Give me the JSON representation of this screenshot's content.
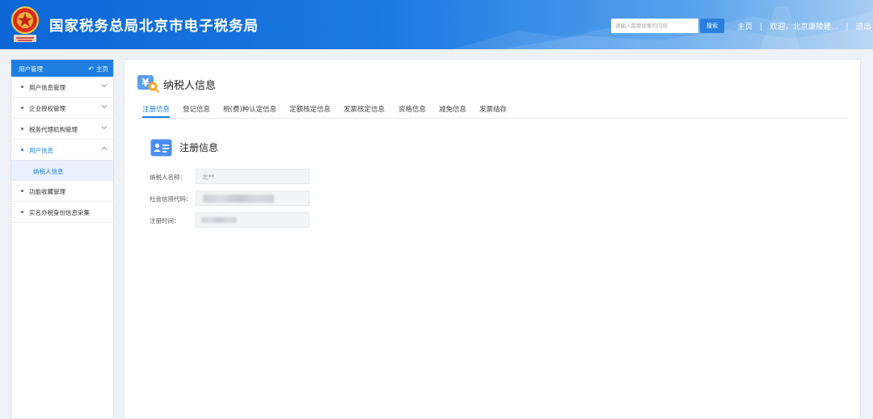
{
  "header": {
    "site_title": "国家税务总局北京市电子税务局",
    "search_placeholder": "请输入需要搜索的内容",
    "search_button": "搜索",
    "nav_home": "主页",
    "separator": "|",
    "welcome": "欢迎，北京康陵建...",
    "logout": "退出",
    "emblem_icon": "tax-emblem-icon"
  },
  "sidebar": {
    "header_title": "用户管理",
    "home_label": "主页",
    "items": [
      {
        "label": "用户信息管理",
        "expandable": true,
        "expanded": false
      },
      {
        "label": "企业授权管理",
        "expandable": true,
        "expanded": false
      },
      {
        "label": "税务代理机构管理",
        "expandable": true,
        "expanded": false
      },
      {
        "label": "用户信息",
        "expandable": true,
        "expanded": true,
        "active": true
      },
      {
        "label": "纳税人信息",
        "sub": true
      },
      {
        "label": "功能收藏管理",
        "expandable": false
      },
      {
        "label": "实名办税身份信息采集",
        "expandable": false
      }
    ]
  },
  "main": {
    "page_title": "纳税人信息",
    "tabs": [
      "注册信息",
      "登记信息",
      "税(费)种认定信息",
      "定额核定信息",
      "发票核定信息",
      "资格信息",
      "减免信息",
      "发票结存"
    ],
    "active_tab": 0,
    "section_title": "注册信息",
    "fields": [
      {
        "label": "纳税人名称：",
        "value": "北**"
      },
      {
        "label": "社会信用代码：",
        "value": ""
      },
      {
        "label": "注册时间：",
        "value": ""
      }
    ]
  },
  "colors": {
    "accent": "#1e7fe0",
    "header_start": "#0d66d6",
    "header_end": "#a7cdf2"
  }
}
